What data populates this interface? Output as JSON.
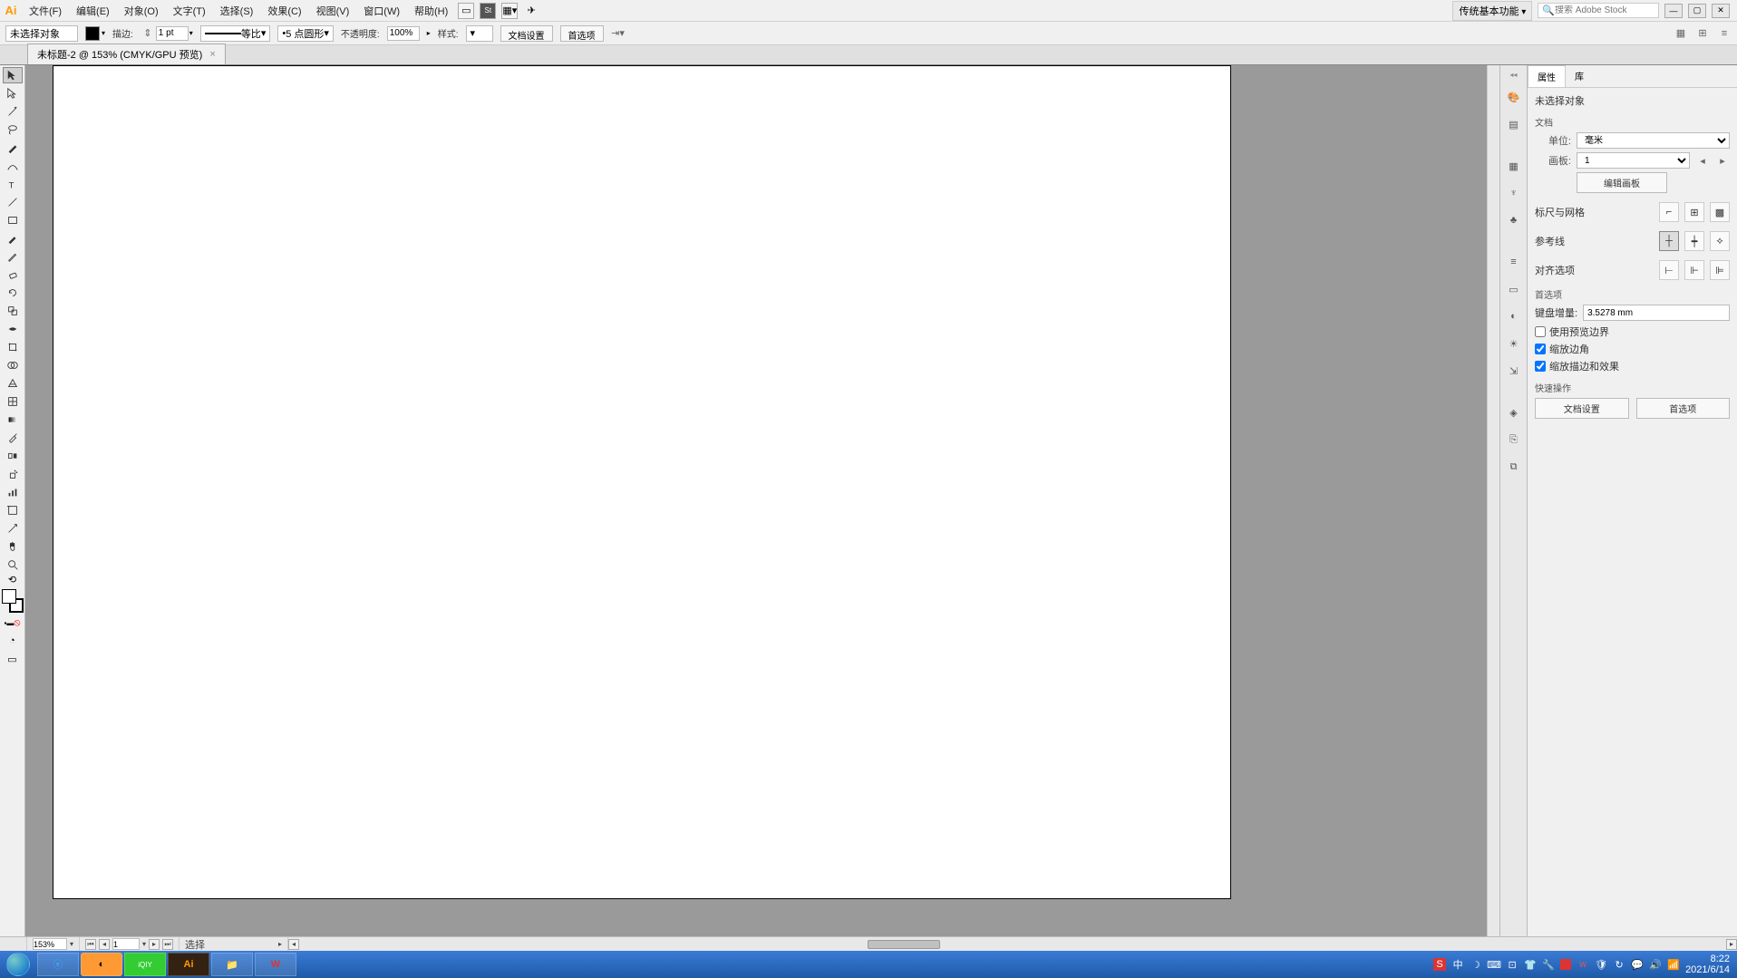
{
  "menubar": {
    "items": [
      "文件(F)",
      "编辑(E)",
      "对象(O)",
      "文字(T)",
      "选择(S)",
      "效果(C)",
      "视图(V)",
      "窗口(W)",
      "帮助(H)"
    ],
    "workspace": "传统基本功能",
    "search_placeholder": "搜索 Adobe Stock"
  },
  "controlbar": {
    "selection": "未选择对象",
    "stroke_label": "描边:",
    "stroke_value": "1 pt",
    "uniform": "等比",
    "dash": "5 点圆形",
    "opacity_label": "不透明度:",
    "opacity_value": "100%",
    "style_label": "样式:",
    "doc_setup": "文档设置",
    "prefs": "首选项"
  },
  "doc_tab": {
    "title": "未标题-2 @ 153% (CMYK/GPU 预览)"
  },
  "right_panel": {
    "tabs": [
      "属性",
      "库"
    ],
    "no_selection": "未选择对象",
    "doc_section": "文档",
    "unit_label": "单位:",
    "unit_value": "毫米",
    "artboard_label": "画板:",
    "artboard_value": "1",
    "edit_artboards": "编辑画板",
    "ruler_grid": "标尺与网格",
    "guides": "参考线",
    "align_opts": "对齐选项",
    "prefs": "首选项",
    "key_inc_label": "键盘增量:",
    "key_inc_value": "3.5278 mm",
    "cb1": "使用预览边界",
    "cb2": "缩放边角",
    "cb3": "缩放描边和效果",
    "quick_actions": "快速操作",
    "btn_doc_setup": "文档设置",
    "btn_prefs": "首选项"
  },
  "statusbar": {
    "zoom": "153%",
    "artboard_nav": "1",
    "tool": "选择"
  },
  "taskbar": {
    "time": "8:22",
    "date": "2021/6/14",
    "ime": "中"
  },
  "tools": [
    "selection",
    "direct-select",
    "wand",
    "lasso",
    "pen",
    "curve",
    "type",
    "line",
    "rect",
    "brush",
    "pencil",
    "eraser",
    "rotate",
    "scale",
    "width",
    "free-transform",
    "shape-builder",
    "perspective",
    "mesh",
    "gradient",
    "eyedropper",
    "blend",
    "symbol-spray",
    "graph",
    "artboard",
    "slice",
    "hand",
    "zoom"
  ],
  "dock_icons": [
    "color",
    "swatches",
    "transparency",
    "character",
    "club",
    "align",
    "stroke",
    "gradient",
    "appearance",
    "layers",
    "asset-export",
    "artboards-panel"
  ]
}
